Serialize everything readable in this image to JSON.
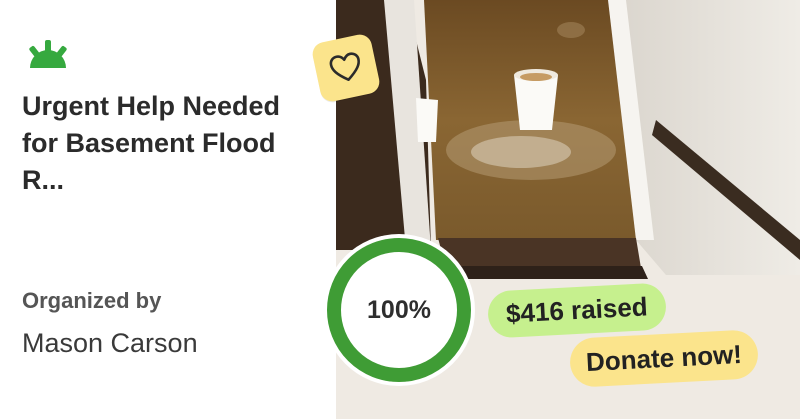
{
  "campaign": {
    "title": "Urgent Help Needed for Basement Flood R...",
    "organizer_label": "Organized by",
    "organizer_name": "Mason Carson",
    "progress_percent": 100,
    "progress_text": "100%",
    "raised_text": "$416 raised",
    "donate_label": "Donate now!"
  },
  "icons": {
    "logo": "sprout-logo-icon",
    "badge": "heart-icon"
  },
  "colors": {
    "brand_green": "#36a93f",
    "ring_green": "#3f9c35",
    "ring_track": "#ffffff",
    "raised_pill": "#c6f08e",
    "donate_pill": "#fbe48c",
    "heart_badge": "#fbe48c"
  }
}
